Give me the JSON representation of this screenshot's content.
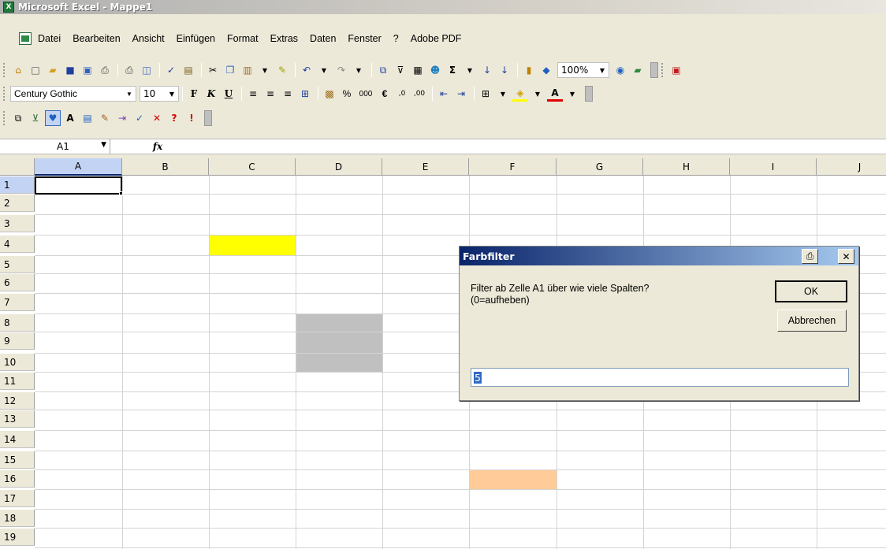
{
  "window": {
    "title": "Microsoft Excel - Mappe1"
  },
  "menu": [
    "Datei",
    "Bearbeiten",
    "Ansicht",
    "Einfügen",
    "Format",
    "Extras",
    "Daten",
    "Fenster",
    "?",
    "Adobe PDF"
  ],
  "toolbar_standard": {
    "zoom": "100%"
  },
  "toolbar_format": {
    "font": "Century Gothic",
    "size": "10",
    "percent": "%",
    "thousands": "000",
    "euro": "€"
  },
  "formula_bar": {
    "name_box": "A1",
    "fx": "fx",
    "value": ""
  },
  "grid": {
    "columns": [
      "A",
      "B",
      "C",
      "D",
      "E",
      "F",
      "G",
      "H",
      "I",
      "J"
    ],
    "rows": [
      "1",
      "2",
      "3",
      "4",
      "5",
      "6",
      "7",
      "8",
      "9",
      "10",
      "11",
      "12",
      "13",
      "14",
      "15",
      "16",
      "17",
      "18",
      "19"
    ],
    "active_cell": "A1",
    "colored_cells": [
      {
        "range": "C4",
        "color": "#ffff00"
      },
      {
        "range": "D8:D10",
        "color": "#c0c0c0"
      },
      {
        "range": "F16",
        "color": "#ffcc99"
      }
    ]
  },
  "dialog": {
    "title": "Farbfilter",
    "prompt": "Filter ab Zelle A1 über wie viele Spalten?\n(0=aufheben)",
    "ok_label": "OK",
    "cancel_label": "Abbrechen",
    "input_value": "5"
  }
}
